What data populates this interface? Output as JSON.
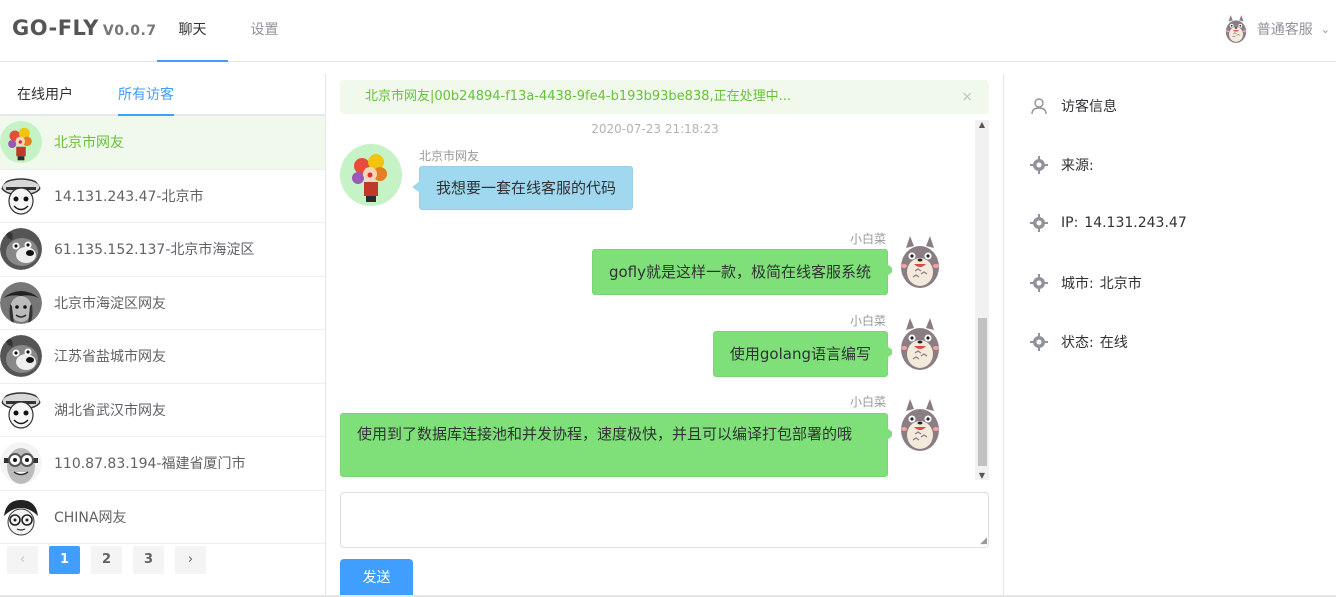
{
  "header": {
    "logo": "GO-FLY",
    "version": "V0.0.7",
    "tabs": [
      {
        "label": "聊天",
        "active": true
      },
      {
        "label": "设置",
        "active": false
      }
    ],
    "agent_name": "普通客服"
  },
  "sidebar": {
    "tabs": [
      {
        "label": "在线用户",
        "active": false
      },
      {
        "label": "所有访客",
        "active": true
      }
    ],
    "visitors": [
      {
        "name": "北京市网友",
        "avatar": "balloon-clown-avatar",
        "active": true
      },
      {
        "name": "14.131.243.47-北京市",
        "avatar": "luffy-avatar"
      },
      {
        "name": "61.135.152.137-北京市海淀区",
        "avatar": "bear-avatar"
      },
      {
        "name": "北京市海淀区网友",
        "avatar": "pirate-avatar"
      },
      {
        "name": "江苏省盐城市网友",
        "avatar": "bear-avatar"
      },
      {
        "name": "湖北省武汉市网友",
        "avatar": "luffy-avatar"
      },
      {
        "name": "110.87.83.194-福建省厦门市",
        "avatar": "minion-avatar"
      },
      {
        "name": "CHINA网友",
        "avatar": "conan-avatar"
      }
    ],
    "pagination": {
      "prev": "‹",
      "pages": [
        "1",
        "2",
        "3"
      ],
      "current": "1",
      "next": "›"
    }
  },
  "chat": {
    "notice": "北京市网友|00b24894-f13a-4438-9fe4-b193b93be838,正在处理中...",
    "notice_close": "×",
    "timestamp": "2020-07-23 21:18:23",
    "messages": [
      {
        "from": "visitor",
        "sender": "北京市网友",
        "text": "我想要一套在线客服的代码"
      },
      {
        "from": "agent",
        "sender": "小白菜",
        "text": "gofly就是这样一款，极简在线客服系统"
      },
      {
        "from": "agent",
        "sender": "小白菜",
        "text": "使用golang语言编写"
      },
      {
        "from": "agent",
        "sender": "小白菜",
        "text": "使用到了数据库连接池和并发协程，速度极快，并且可以编译打包部署的哦"
      }
    ],
    "input_value": "",
    "send_label": "发送"
  },
  "info": {
    "title": "访客信息",
    "source_label": "来源:",
    "source_value": "",
    "ip_label": "IP:",
    "ip_value": "14.131.243.47",
    "city_label": "城市:",
    "city_value": "北京市",
    "status_label": "状态:",
    "status_value": "在线"
  },
  "colors": {
    "primary": "#409eff",
    "success": "#67c23a",
    "agent_bubble": "#7fe07a",
    "visitor_bubble": "#a0d8ef"
  }
}
